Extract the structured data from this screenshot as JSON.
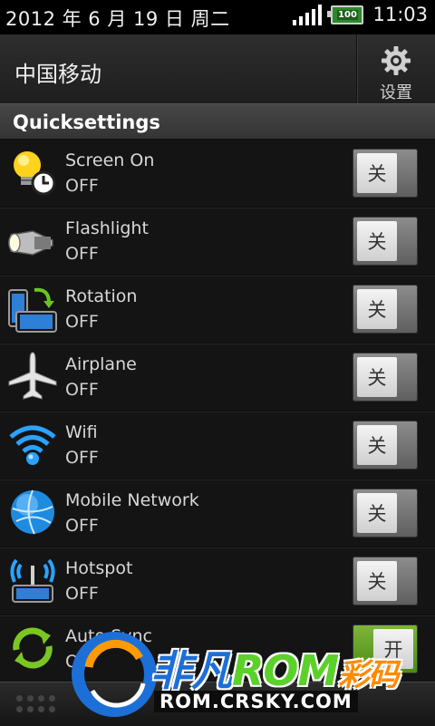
{
  "status_bar": {
    "date": "2012 年 6 月 19 日 周二",
    "battery_level": "100",
    "time": "11:03"
  },
  "header": {
    "carrier": "中国移动",
    "settings_label": "设置"
  },
  "section": {
    "title": "Quicksettings"
  },
  "toggles": [
    {
      "name": "Screen On",
      "state": "OFF",
      "switch_label": "关",
      "on": false,
      "icon": "lightbulb-clock-icon"
    },
    {
      "name": "Flashlight",
      "state": "OFF",
      "switch_label": "关",
      "on": false,
      "icon": "flashlight-icon"
    },
    {
      "name": "Rotation",
      "state": "OFF",
      "switch_label": "关",
      "on": false,
      "icon": "rotation-icon"
    },
    {
      "name": "Airplane",
      "state": "OFF",
      "switch_label": "关",
      "on": false,
      "icon": "airplane-icon"
    },
    {
      "name": "Wifi",
      "state": "OFF",
      "switch_label": "关",
      "on": false,
      "icon": "wifi-icon"
    },
    {
      "name": "Mobile Network",
      "state": "OFF",
      "switch_label": "关",
      "on": false,
      "icon": "globe-icon"
    },
    {
      "name": "Hotspot",
      "state": "OFF",
      "switch_label": "关",
      "on": false,
      "icon": "hotspot-icon"
    },
    {
      "name": "Auto Sync",
      "state": "ON",
      "switch_label": "开",
      "on": true,
      "icon": "sync-icon"
    }
  ],
  "watermark": {
    "brand_a": "非凡",
    "brand_b": "ROM",
    "brand_c": "彩码",
    "url": "ROM.CRSKY.COM"
  },
  "colors": {
    "accent_on": "#5a9c1f",
    "background": "#141414"
  }
}
